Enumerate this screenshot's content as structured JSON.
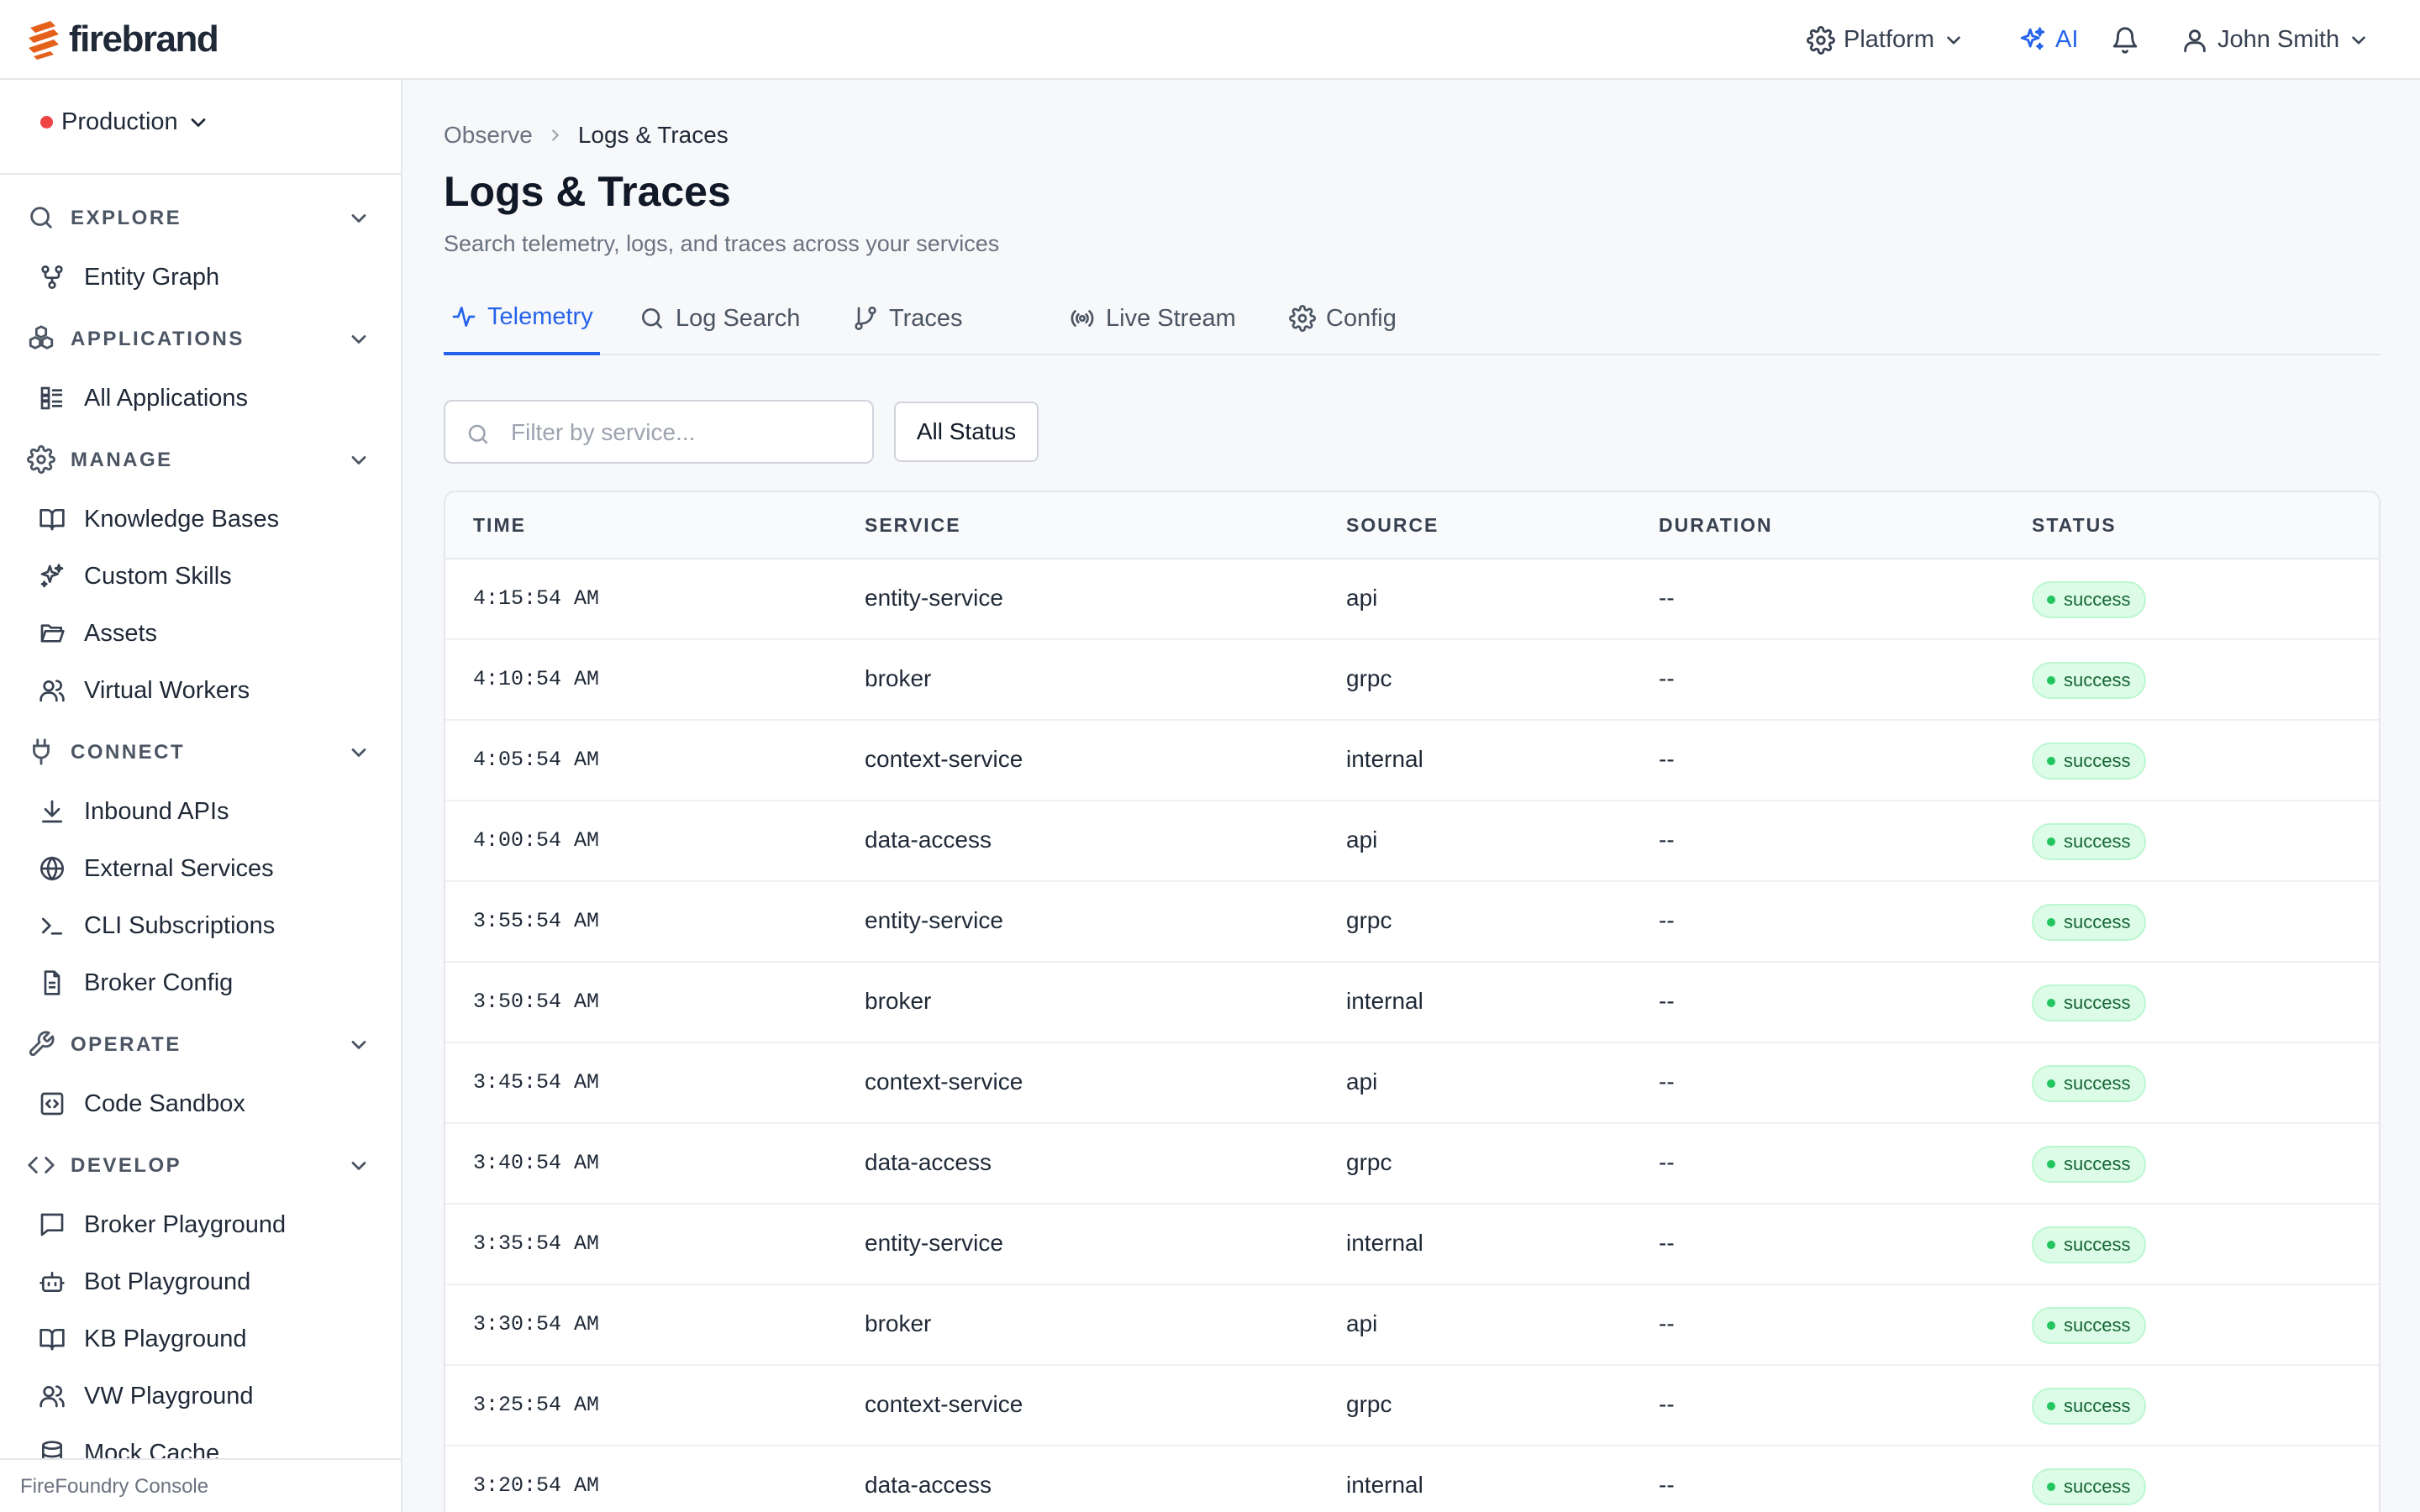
{
  "app": {
    "brand": "firebrand",
    "colors": {
      "brand_orange": "#e4611b",
      "accent_blue": "#2563eb",
      "env_red": "#ef4444",
      "success_green": "#22c55e"
    }
  },
  "topbar": {
    "platform_label": "Platform",
    "ai_label": "AI",
    "user_name": "John Smith"
  },
  "sidebar": {
    "environment": "Production",
    "sections": [
      {
        "label": "EXPLORE",
        "icon": "search-icon",
        "items": [
          {
            "label": "Entity Graph",
            "icon": "graph-nodes-icon"
          }
        ]
      },
      {
        "label": "APPLICATIONS",
        "icon": "cubes-icon",
        "items": [
          {
            "label": "All Applications",
            "icon": "list-grid-icon"
          }
        ]
      },
      {
        "label": "MANAGE",
        "icon": "gear-icon",
        "items": [
          {
            "label": "Knowledge Bases",
            "icon": "book-icon"
          },
          {
            "label": "Custom Skills",
            "icon": "sparkles-icon"
          },
          {
            "label": "Assets",
            "icon": "folder-icon"
          },
          {
            "label": "Virtual Workers",
            "icon": "users-icon"
          }
        ]
      },
      {
        "label": "CONNECT",
        "icon": "plug-icon",
        "items": [
          {
            "label": "Inbound APIs",
            "icon": "download-icon"
          },
          {
            "label": "External Services",
            "icon": "globe-icon"
          },
          {
            "label": "CLI Subscriptions",
            "icon": "terminal-icon"
          },
          {
            "label": "Broker Config",
            "icon": "file-icon"
          }
        ]
      },
      {
        "label": "OPERATE",
        "icon": "wrench-icon",
        "items": [
          {
            "label": "Code Sandbox",
            "icon": "code-box-icon"
          }
        ]
      },
      {
        "label": "DEVELOP",
        "icon": "code-icon",
        "items": [
          {
            "label": "Broker Playground",
            "icon": "chat-icon"
          },
          {
            "label": "Bot Playground",
            "icon": "bot-icon"
          },
          {
            "label": "KB Playground",
            "icon": "book-icon"
          },
          {
            "label": "VW Playground",
            "icon": "users-icon"
          },
          {
            "label": "Mock Cache",
            "icon": "database-icon"
          }
        ]
      }
    ],
    "footer": "FireFoundry Console"
  },
  "page": {
    "breadcrumb": {
      "parent": "Observe",
      "current": "Logs & Traces"
    },
    "title": "Logs & Traces",
    "subtitle": "Search telemetry, logs, and traces across your services",
    "tabs": [
      {
        "label": "Telemetry",
        "icon": "activity-icon",
        "active": true
      },
      {
        "label": "Log Search",
        "icon": "search-icon",
        "active": false
      },
      {
        "label": "Traces",
        "icon": "git-branch-icon",
        "active": false
      },
      {
        "label": "Live Stream",
        "icon": "broadcast-icon",
        "active": false
      },
      {
        "label": "Config",
        "icon": "gear-icon",
        "active": false
      }
    ],
    "filter": {
      "placeholder": "Filter by service...",
      "value": ""
    },
    "status_filter": "All Status"
  },
  "table": {
    "columns": [
      "TIME",
      "SERVICE",
      "SOURCE",
      "DURATION",
      "STATUS"
    ],
    "rows": [
      {
        "time": "4:15:54 AM",
        "service": "entity-service",
        "source": "api",
        "duration": "--",
        "status": "success"
      },
      {
        "time": "4:10:54 AM",
        "service": "broker",
        "source": "grpc",
        "duration": "--",
        "status": "success"
      },
      {
        "time": "4:05:54 AM",
        "service": "context-service",
        "source": "internal",
        "duration": "--",
        "status": "success"
      },
      {
        "time": "4:00:54 AM",
        "service": "data-access",
        "source": "api",
        "duration": "--",
        "status": "success"
      },
      {
        "time": "3:55:54 AM",
        "service": "entity-service",
        "source": "grpc",
        "duration": "--",
        "status": "success"
      },
      {
        "time": "3:50:54 AM",
        "service": "broker",
        "source": "internal",
        "duration": "--",
        "status": "success"
      },
      {
        "time": "3:45:54 AM",
        "service": "context-service",
        "source": "api",
        "duration": "--",
        "status": "success"
      },
      {
        "time": "3:40:54 AM",
        "service": "data-access",
        "source": "grpc",
        "duration": "--",
        "status": "success"
      },
      {
        "time": "3:35:54 AM",
        "service": "entity-service",
        "source": "internal",
        "duration": "--",
        "status": "success"
      },
      {
        "time": "3:30:54 AM",
        "service": "broker",
        "source": "api",
        "duration": "--",
        "status": "success"
      },
      {
        "time": "3:25:54 AM",
        "service": "context-service",
        "source": "grpc",
        "duration": "--",
        "status": "success"
      },
      {
        "time": "3:20:54 AM",
        "service": "data-access",
        "source": "internal",
        "duration": "--",
        "status": "success"
      }
    ]
  }
}
